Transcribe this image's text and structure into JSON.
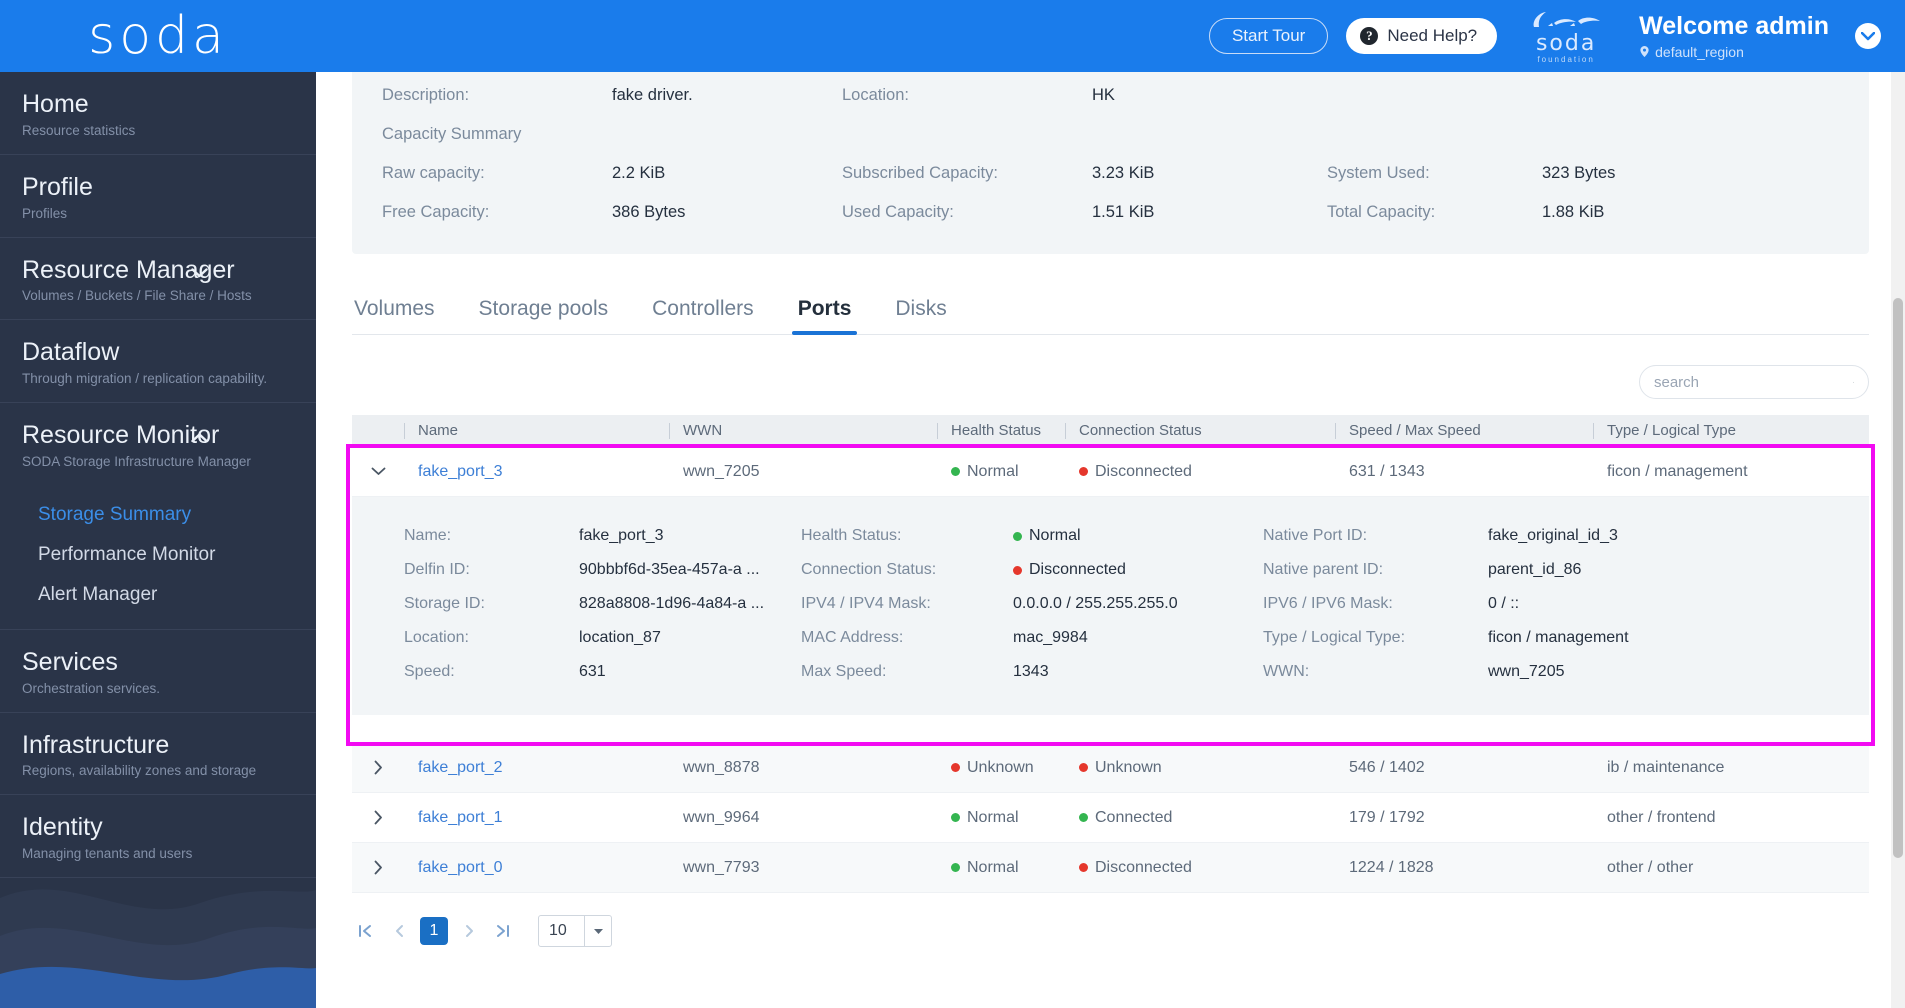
{
  "header": {
    "logo_text": "soda",
    "start_tour_label": "Start Tour",
    "need_help_label": "Need Help?",
    "foundation_text": "soda",
    "foundation_sub": "foundation",
    "welcome_text": "Welcome admin",
    "region": "default_region",
    "brand_color": "#1a7ceb"
  },
  "sidebar": {
    "items": [
      {
        "title": "Home",
        "subtitle": "Resource statistics",
        "caret": ""
      },
      {
        "title": "Profile",
        "subtitle": "Profiles",
        "caret": ""
      },
      {
        "title": "Resource Manager",
        "subtitle": "Volumes / Buckets / File Share / Hosts",
        "caret": "chevron-down"
      },
      {
        "title": "Dataflow",
        "subtitle": "Through migration / replication capability.",
        "caret": ""
      },
      {
        "title": "Resource Monitor",
        "subtitle": "SODA Storage Infrastructure Manager",
        "caret": "chevron-up"
      },
      {
        "title": "Services",
        "subtitle": "Orchestration services.",
        "caret": ""
      },
      {
        "title": "Infrastructure",
        "subtitle": "Regions, availability zones and storage",
        "caret": ""
      },
      {
        "title": "Identity",
        "subtitle": "Managing tenants and users",
        "caret": ""
      }
    ],
    "submenu": [
      {
        "label": "Storage Summary",
        "active": true
      },
      {
        "label": "Performance Monitor",
        "active": false
      },
      {
        "label": "Alert Manager",
        "active": false
      }
    ],
    "active_color": "#3b8ee8"
  },
  "summary": {
    "rows": [
      {
        "l1": "Description:",
        "v1": "fake driver.",
        "l2": "Location:",
        "v2": "HK",
        "l3": "",
        "v3": ""
      },
      {
        "l1": "Raw capacity:",
        "v1": "2.2 KiB",
        "l2": "Subscribed Capacity:",
        "v2": "3.23 KiB",
        "l3": "System Used:",
        "v3": "323 Bytes"
      },
      {
        "l1": "Free Capacity:",
        "v1": "386 Bytes",
        "l2": "Used Capacity:",
        "v2": "1.51 KiB",
        "l3": "Total Capacity:",
        "v3": "1.88 KiB"
      }
    ],
    "section_label": "Capacity Summary"
  },
  "tabs": [
    {
      "label": "Volumes",
      "active": false
    },
    {
      "label": "Storage pools",
      "active": false
    },
    {
      "label": "Controllers",
      "active": false
    },
    {
      "label": "Ports",
      "active": true
    },
    {
      "label": "Disks",
      "active": false
    }
  ],
  "search": {
    "placeholder": "search",
    "value": "",
    "icon": "search-icon"
  },
  "table": {
    "columns": [
      "Name",
      "WWN",
      "Health Status",
      "Connection Status",
      "Speed / Max Speed",
      "Type / Logical Type"
    ],
    "rows": [
      {
        "name": "fake_port_3",
        "wwn": "wwn_7205",
        "health": "Normal",
        "health_dot": "green",
        "conn": "Disconnected",
        "conn_dot": "red",
        "speed": "631 / 1343",
        "type": "ficon / management",
        "expanded": true,
        "highlighted": true
      },
      {
        "name": "fake_port_2",
        "wwn": "wwn_8878",
        "health": "Unknown",
        "health_dot": "red",
        "conn": "Unknown",
        "conn_dot": "red",
        "speed": "546 / 1402",
        "type": "ib / maintenance",
        "expanded": false,
        "highlighted": false
      },
      {
        "name": "fake_port_1",
        "wwn": "wwn_9964",
        "health": "Normal",
        "health_dot": "green",
        "conn": "Connected",
        "conn_dot": "green",
        "speed": "179 / 1792",
        "type": "other / frontend",
        "expanded": false,
        "highlighted": false
      },
      {
        "name": "fake_port_0",
        "wwn": "wwn_7793",
        "health": "Normal",
        "health_dot": "green",
        "conn": "Disconnected",
        "conn_dot": "red",
        "speed": "1224 / 1828",
        "type": "other / other",
        "expanded": false,
        "highlighted": false
      }
    ]
  },
  "detail": {
    "rows": [
      {
        "l1": "Name:",
        "v1": "fake_port_3",
        "l2": "Health Status:",
        "v2": "Normal",
        "v2dot": "green",
        "l3": "Native Port ID:",
        "v3": "fake_original_id_3"
      },
      {
        "l1": "Delfin ID:",
        "v1": "90bbbf6d-35ea-457a-a ...",
        "l2": "Connection Status:",
        "v2": "Disconnected",
        "v2dot": "red",
        "l3": "Native parent ID:",
        "v3": "parent_id_86"
      },
      {
        "l1": "Storage ID:",
        "v1": "828a8808-1d96-4a84-a ...",
        "l2": "IPV4 / IPV4 Mask:",
        "v2": "0.0.0.0 / 255.255.255.0",
        "v2dot": "",
        "l3": "IPV6 / IPV6 Mask:",
        "v3": "0 / ::"
      },
      {
        "l1": "Location:",
        "v1": "location_87",
        "l2": "MAC Address:",
        "v2": "mac_9984",
        "v2dot": "",
        "l3": "Type / Logical Type:",
        "v3": "ficon / management"
      },
      {
        "l1": "Speed:",
        "v1": "631",
        "l2": "Max Speed:",
        "v2": "1343",
        "v2dot": "",
        "l3": "WWN:",
        "v3": "wwn_7205"
      }
    ]
  },
  "pagination": {
    "first": "first-page",
    "prev": "prev-page",
    "page": "1",
    "next": "next-page",
    "last": "last-page",
    "page_size": "10"
  },
  "colors": {
    "accent": "#1a7ceb",
    "highlight": "#f20af2",
    "status_green": "#34b550",
    "status_red": "#e5372c"
  }
}
